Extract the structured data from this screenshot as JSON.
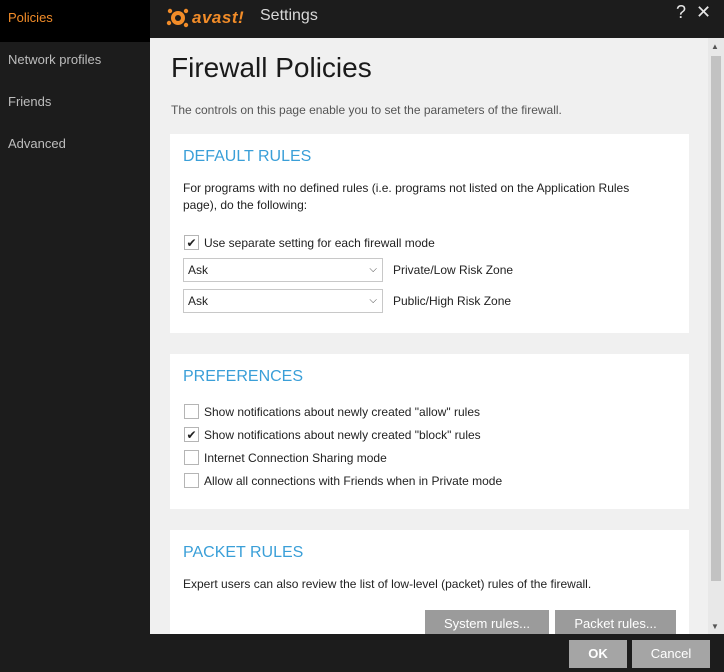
{
  "sidebar": {
    "items": [
      {
        "label": "Policies",
        "active": true
      },
      {
        "label": "Network profiles"
      },
      {
        "label": "Friends"
      },
      {
        "label": "Advanced"
      }
    ]
  },
  "titlebar": {
    "brand": "avast!",
    "title": "Settings",
    "help": "?",
    "close": "✕"
  },
  "page": {
    "title": "Firewall Policies",
    "description": "The controls on this page enable you to set the parameters of the firewall."
  },
  "default_rules": {
    "heading": "DEFAULT RULES",
    "text": "For programs with no defined rules (i.e. programs not listed on the Application Rules page), do the following:",
    "separate_setting": {
      "label": "Use separate setting for each firewall mode",
      "checked": true
    },
    "private_zone": {
      "value": "Ask",
      "label": "Private/Low Risk Zone"
    },
    "public_zone": {
      "value": "Ask",
      "label": "Public/High Risk Zone"
    }
  },
  "preferences": {
    "heading": "PREFERENCES",
    "options": [
      {
        "label": "Show notifications about newly created \"allow\" rules",
        "checked": false
      },
      {
        "label": "Show notifications about newly created \"block\" rules",
        "checked": true
      },
      {
        "label": "Internet Connection Sharing mode",
        "checked": false
      },
      {
        "label": "Allow all connections with Friends when in Private mode",
        "checked": false
      }
    ]
  },
  "packet_rules": {
    "heading": "PACKET RULES",
    "text": "Expert users can also review the list of low-level (packet) rules of the firewall.",
    "system_rules": "System rules...",
    "packet_rules": "Packet rules..."
  },
  "footer": {
    "ok": "OK",
    "cancel": "Cancel"
  },
  "colors": {
    "accent": "#f28c28",
    "heading_blue": "#3a9fd8",
    "dark_bg": "#1c1c1c",
    "content_bg": "#f0f0f0"
  }
}
